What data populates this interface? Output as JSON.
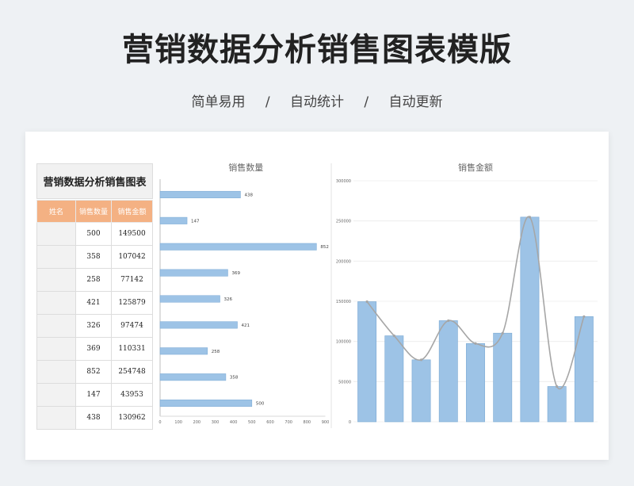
{
  "page": {
    "title": "营销数据分析销售图表模版",
    "features": [
      "简单易用",
      "自动统计",
      "自动更新"
    ],
    "separator": "/"
  },
  "sheet": {
    "title": "营销数据分析销售图表",
    "headers": [
      "姓名",
      "销售数量",
      "销售金额"
    ],
    "rows": [
      {
        "name": "",
        "qty": "500",
        "amount": "149500"
      },
      {
        "name": "",
        "qty": "358",
        "amount": "107042"
      },
      {
        "name": "",
        "qty": "258",
        "amount": "77142"
      },
      {
        "name": "",
        "qty": "421",
        "amount": "125879"
      },
      {
        "name": "",
        "qty": "326",
        "amount": "97474"
      },
      {
        "name": "",
        "qty": "369",
        "amount": "110331"
      },
      {
        "name": "",
        "qty": "852",
        "amount": "254748"
      },
      {
        "name": "",
        "qty": "147",
        "amount": "43953"
      },
      {
        "name": "",
        "qty": "438",
        "amount": "130962"
      }
    ]
  },
  "colors": {
    "bar": "#9dc3e6",
    "bar_edge": "#7aa9d4",
    "line": "#a6a6a6",
    "header": "#f4b183"
  },
  "chart_data": [
    {
      "type": "bar",
      "orientation": "horizontal",
      "title": "销售数量",
      "values_top_to_bottom": [
        438,
        147,
        852,
        369,
        326,
        421,
        258,
        358,
        500
      ],
      "xlim": [
        0,
        900
      ],
      "xticks": [
        0,
        100,
        200,
        300,
        400,
        500,
        600,
        700,
        800,
        900
      ],
      "data_labels": true
    },
    {
      "type": "bar",
      "title": "销售金额",
      "values": [
        149500,
        107042,
        77142,
        125879,
        97474,
        110331,
        254748,
        43953,
        130962
      ],
      "ylim": [
        0,
        300000
      ],
      "yticks": [
        0,
        50000,
        100000,
        150000,
        200000,
        250000,
        300000
      ],
      "overlay": "smoothed-line",
      "grid": true
    }
  ]
}
